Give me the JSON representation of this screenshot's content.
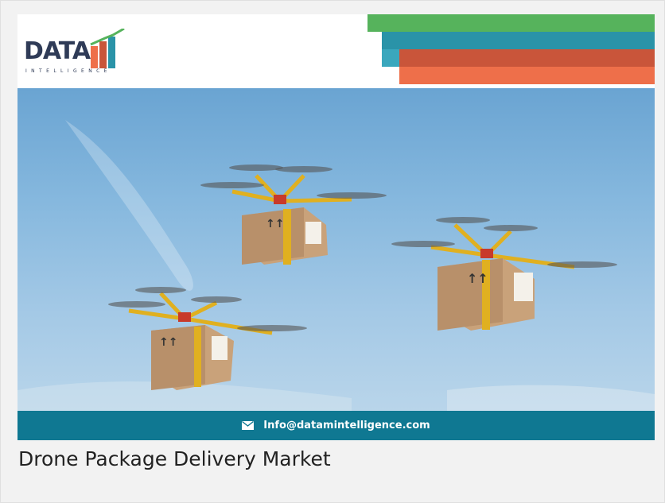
{
  "brand": {
    "logo_word": "DATA",
    "logo_sub": "INTELLIGENCE",
    "colors": {
      "navy": "#2f3b57",
      "green": "#56b35c",
      "teal": "#2a93a8",
      "rust": "#c9553a",
      "orange": "#ee6f4a",
      "footer": "#0f7892"
    }
  },
  "banner": {
    "image_subject": "three delivery drones carrying packages",
    "email_icon": "mail-icon",
    "email": "Info@datamintelligence.com"
  },
  "caption": {
    "title": "Drone Package Delivery Market"
  }
}
